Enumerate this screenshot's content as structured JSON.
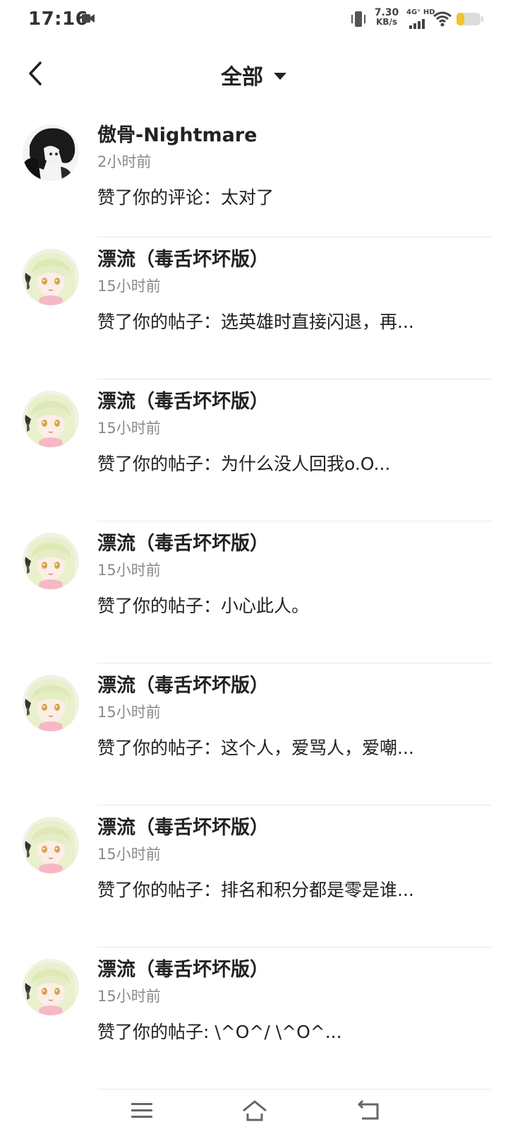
{
  "status_bar": {
    "time": "17:16",
    "net_speed_value": "7.30",
    "net_speed_unit": "KB/s",
    "signal_label": "4G⁺ HD"
  },
  "header": {
    "title": "全部"
  },
  "notifications": [
    {
      "name": "傲骨-Nightmare",
      "time": "2小时前",
      "text": "赞了你的评论：太对了",
      "avatar": "dark"
    },
    {
      "name": "漂流（毒舌坏坏版）",
      "time": "15小时前",
      "text": "赞了你的帖子：选英雄时直接闪退，再...",
      "avatar": "anime"
    },
    {
      "name": "漂流（毒舌坏坏版）",
      "time": "15小时前",
      "text": "赞了你的帖子：为什么没人回我o.O...",
      "avatar": "anime"
    },
    {
      "name": "漂流（毒舌坏坏版）",
      "time": "15小时前",
      "text": "赞了你的帖子：小心此人。",
      "avatar": "anime"
    },
    {
      "name": "漂流（毒舌坏坏版）",
      "time": "15小时前",
      "text": "赞了你的帖子：这个人，爱骂人，爱嘲...",
      "avatar": "anime"
    },
    {
      "name": "漂流（毒舌坏坏版）",
      "time": "15小时前",
      "text": "赞了你的帖子：排名和积分都是零是谁...",
      "avatar": "anime"
    },
    {
      "name": "漂流（毒舌坏坏版）",
      "time": "15小时前",
      "text": "赞了你的帖子: \\^O^/ \\^O^...",
      "avatar": "anime"
    }
  ],
  "colors": {
    "text_primary": "#222222",
    "text_secondary": "#8a8a8a",
    "divider": "#e8e8e8",
    "battery": "#f2c230"
  },
  "icons": [
    "back-arrow-icon",
    "dropdown-triangle-icon",
    "menu-icon",
    "home-icon",
    "back-icon",
    "camera-icon",
    "vibrate-icon",
    "signal-icon",
    "wifi-icon",
    "battery-icon"
  ]
}
